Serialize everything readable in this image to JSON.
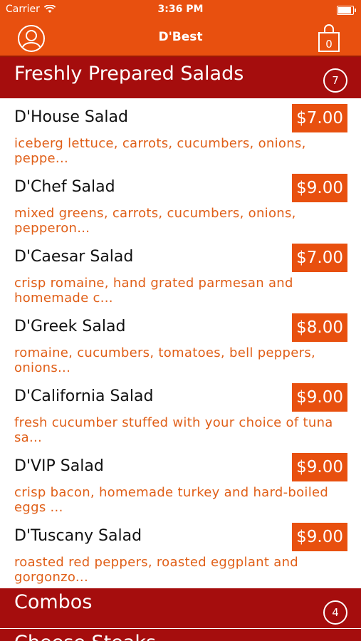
{
  "status": {
    "carrier": "Carrier",
    "time": "3:36 PM"
  },
  "nav": {
    "title": "D'Best",
    "left_icon": "profile-icon",
    "right_icon": "shopping-bag-icon",
    "bag_count": "0"
  },
  "sections": [
    {
      "title": "Freshly Prepared Salads",
      "count": "7"
    },
    {
      "title": "Combos",
      "count": "4"
    },
    {
      "title": "Cheese Steaks"
    }
  ],
  "items": [
    {
      "name": "D'House Salad",
      "price": "$7.00",
      "desc": "iceberg lettuce, carrots, cucumbers, onions, peppe..."
    },
    {
      "name": "D'Chef Salad",
      "price": "$9.00",
      "desc": "mixed greens, carrots, cucumbers, onions, pepperon..."
    },
    {
      "name": "D'Caesar Salad",
      "price": "$7.00",
      "desc": "crisp romaine, hand grated parmesan and homemade c..."
    },
    {
      "name": "D'Greek Salad",
      "price": "$8.00",
      "desc": "romaine, cucumbers, tomatoes, bell peppers, onions..."
    },
    {
      "name": "D'California Salad",
      "price": "$9.00",
      "desc": "fresh cucumber stuffed with your choice of tuna sa..."
    },
    {
      "name": "D'VIP Salad",
      "price": "$9.00",
      "desc": "crisp bacon, homemade turkey and hard-boiled eggs ..."
    },
    {
      "name": "D'Tuscany Salad",
      "price": "$9.00",
      "desc": "roasted red peppers, roasted eggplant and gorgonzo..."
    }
  ],
  "colors": {
    "brand_orange": "#e8500f",
    "section_red": "#a50d0d",
    "desc_orange": "#e05f18"
  }
}
